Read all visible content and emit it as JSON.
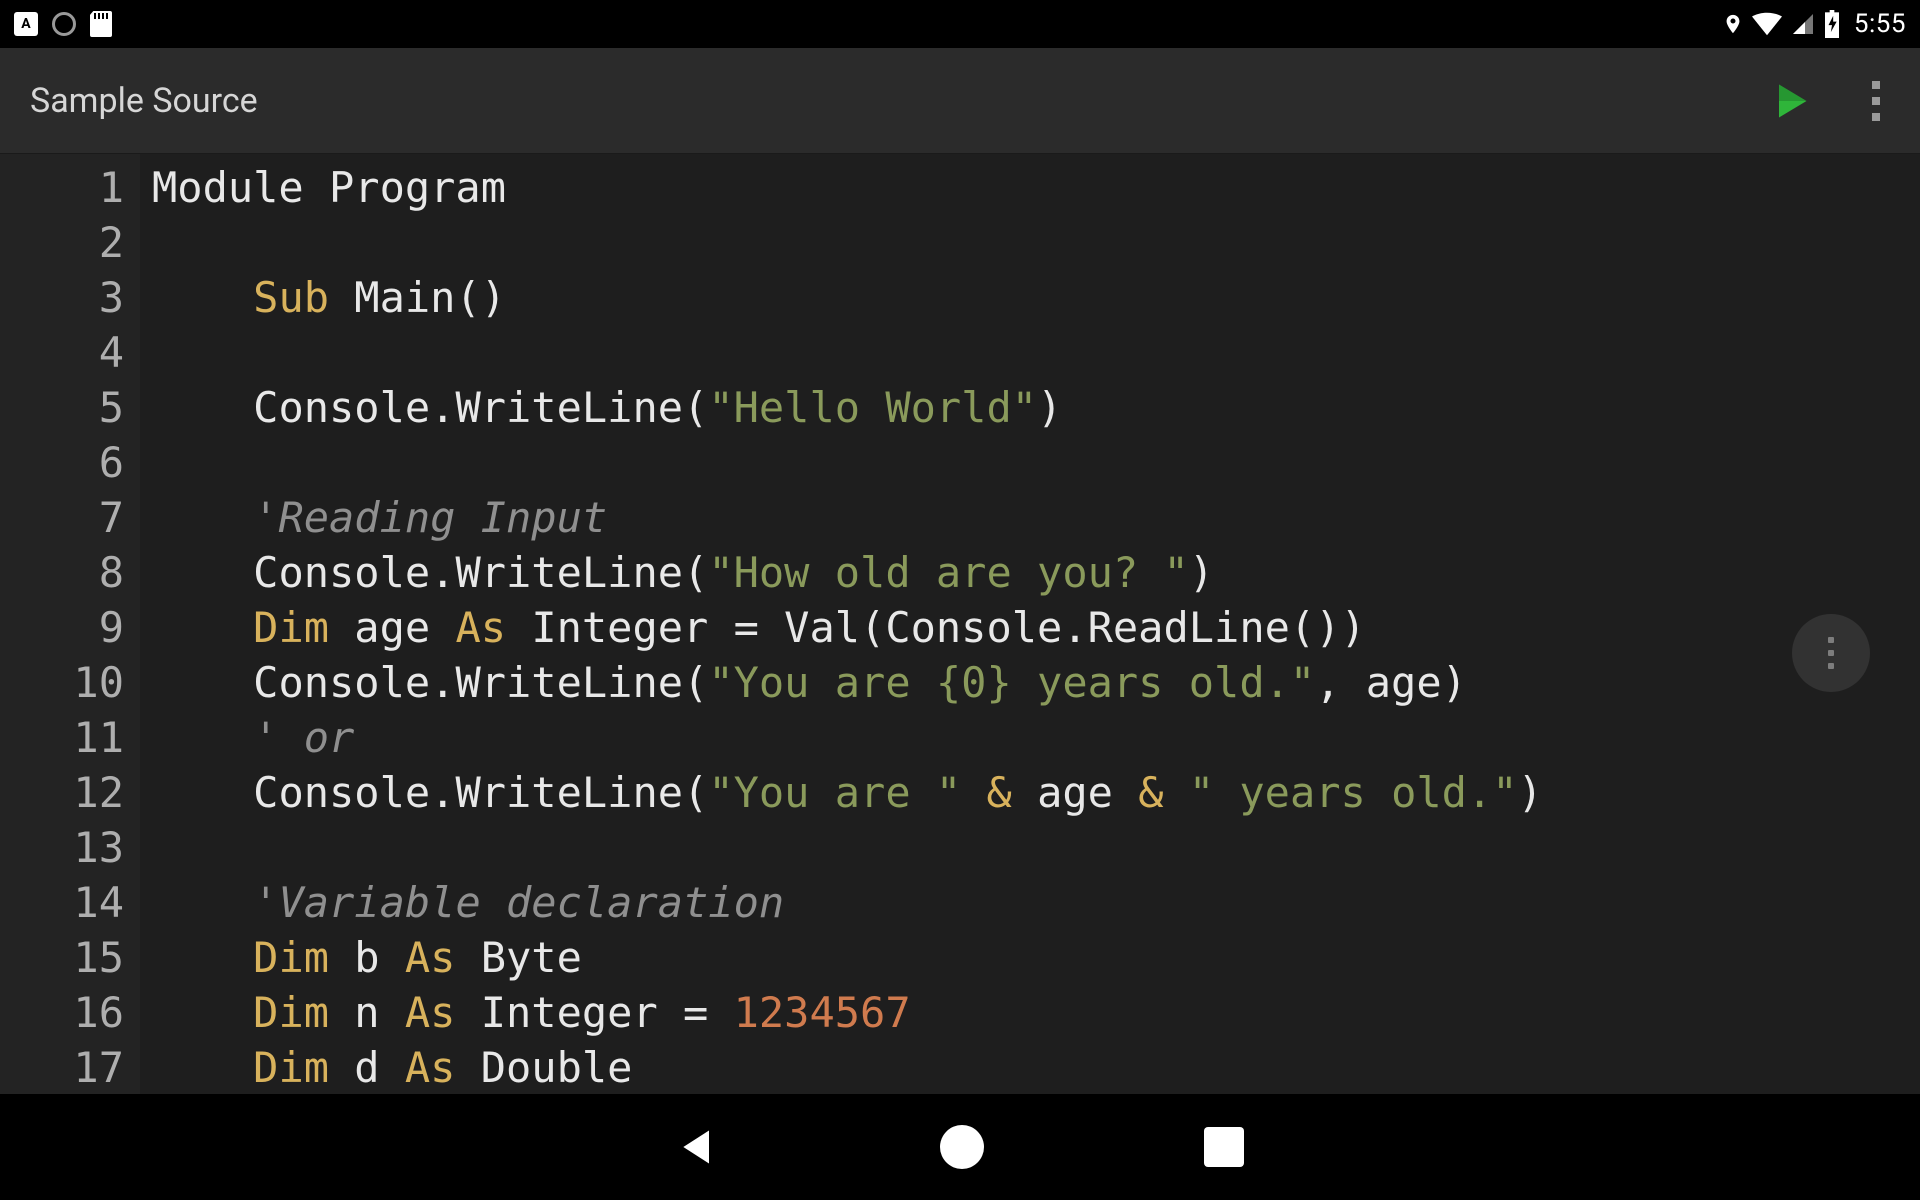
{
  "status_bar": {
    "left_icons": [
      "keyboard-app-icon",
      "record-icon",
      "sd-card-icon"
    ],
    "right_icons": [
      "location-icon",
      "wifi-icon",
      "cell-signal-icon",
      "battery-charging-icon"
    ],
    "time": "5:55"
  },
  "app_bar": {
    "title": "Sample Source",
    "actions": [
      "run-button",
      "overflow-menu-button"
    ]
  },
  "colors": {
    "background": "#1e1e1e",
    "gutter": "#232323",
    "keyword": "#d8b25c",
    "string": "#8a9a5b",
    "comment": "#8f8f8f",
    "number": "#d07b4e",
    "run_accent": "#2fb53a"
  },
  "editor": {
    "line_numbers": [
      "1",
      "2",
      "3",
      "4",
      "5",
      "6",
      "7",
      "8",
      "9",
      "10",
      "11",
      "12",
      "13",
      "14",
      "15",
      "16",
      "17"
    ],
    "code_lines": [
      [
        {
          "t": "plain",
          "v": "Module Program"
        }
      ],
      [],
      [
        {
          "t": "indent",
          "v": "    "
        },
        {
          "t": "kw",
          "v": "Sub"
        },
        {
          "t": "plain",
          "v": " Main()"
        }
      ],
      [],
      [
        {
          "t": "indent",
          "v": "    "
        },
        {
          "t": "plain",
          "v": "Console.WriteLine("
        },
        {
          "t": "str",
          "v": "\"Hello World\""
        },
        {
          "t": "plain",
          "v": ")"
        }
      ],
      [],
      [
        {
          "t": "indent",
          "v": "    "
        },
        {
          "t": "cmt",
          "v": "'Reading Input"
        }
      ],
      [
        {
          "t": "indent",
          "v": "    "
        },
        {
          "t": "plain",
          "v": "Console.WriteLine("
        },
        {
          "t": "str",
          "v": "\"How old are you? \""
        },
        {
          "t": "plain",
          "v": ")"
        }
      ],
      [
        {
          "t": "indent",
          "v": "    "
        },
        {
          "t": "kw",
          "v": "Dim"
        },
        {
          "t": "plain",
          "v": " age "
        },
        {
          "t": "kw",
          "v": "As"
        },
        {
          "t": "plain",
          "v": " Integer = Val(Console.ReadLine())"
        }
      ],
      [
        {
          "t": "indent",
          "v": "    "
        },
        {
          "t": "plain",
          "v": "Console.WriteLine("
        },
        {
          "t": "str",
          "v": "\"You are {0} years old.\""
        },
        {
          "t": "plain",
          "v": ", age)"
        }
      ],
      [
        {
          "t": "indent",
          "v": "    "
        },
        {
          "t": "cmt",
          "v": "' or"
        }
      ],
      [
        {
          "t": "indent",
          "v": "    "
        },
        {
          "t": "plain",
          "v": "Console.WriteLine("
        },
        {
          "t": "str",
          "v": "\"You are \""
        },
        {
          "t": "plain",
          "v": " "
        },
        {
          "t": "op",
          "v": "&"
        },
        {
          "t": "plain",
          "v": " age "
        },
        {
          "t": "op",
          "v": "&"
        },
        {
          "t": "plain",
          "v": " "
        },
        {
          "t": "str",
          "v": "\" years old.\""
        },
        {
          "t": "plain",
          "v": ")"
        }
      ],
      [],
      [
        {
          "t": "indent",
          "v": "    "
        },
        {
          "t": "cmt",
          "v": "'Variable declaration"
        }
      ],
      [
        {
          "t": "indent",
          "v": "    "
        },
        {
          "t": "kw",
          "v": "Dim"
        },
        {
          "t": "plain",
          "v": " b "
        },
        {
          "t": "kw",
          "v": "As"
        },
        {
          "t": "plain",
          "v": " Byte"
        }
      ],
      [
        {
          "t": "indent",
          "v": "    "
        },
        {
          "t": "kw",
          "v": "Dim"
        },
        {
          "t": "plain",
          "v": " n "
        },
        {
          "t": "kw",
          "v": "As"
        },
        {
          "t": "plain",
          "v": " Integer = "
        },
        {
          "t": "num",
          "v": "1234567"
        }
      ],
      [
        {
          "t": "indent",
          "v": "    "
        },
        {
          "t": "kw",
          "v": "Dim"
        },
        {
          "t": "plain",
          "v": " d "
        },
        {
          "t": "kw",
          "v": "As"
        },
        {
          "t": "plain",
          "v": " Double"
        }
      ]
    ]
  },
  "floating_button": "editor-overflow-button",
  "nav_bar": {
    "buttons": [
      "nav-back-button",
      "nav-home-button",
      "nav-recent-button"
    ]
  }
}
